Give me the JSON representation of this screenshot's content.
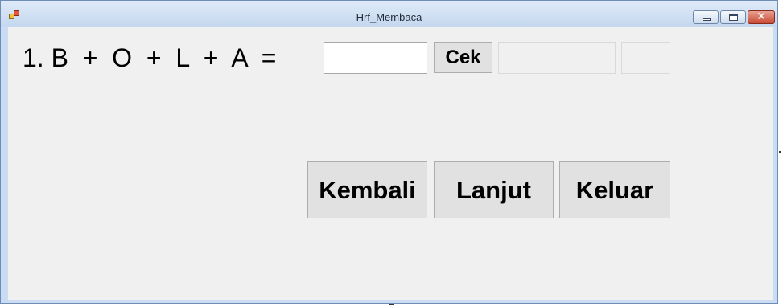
{
  "window": {
    "title": "Hrf_Membaca"
  },
  "question": {
    "number": "1.",
    "letters": [
      "B",
      "O",
      "L",
      "A"
    ],
    "plus": "+",
    "equals": "=",
    "answer_value": "",
    "cek_label": "Cek",
    "result_text": "",
    "score_text": ""
  },
  "buttons": {
    "kembali": "Kembali",
    "lanjut": "Lanjut",
    "keluar": "Keluar"
  }
}
